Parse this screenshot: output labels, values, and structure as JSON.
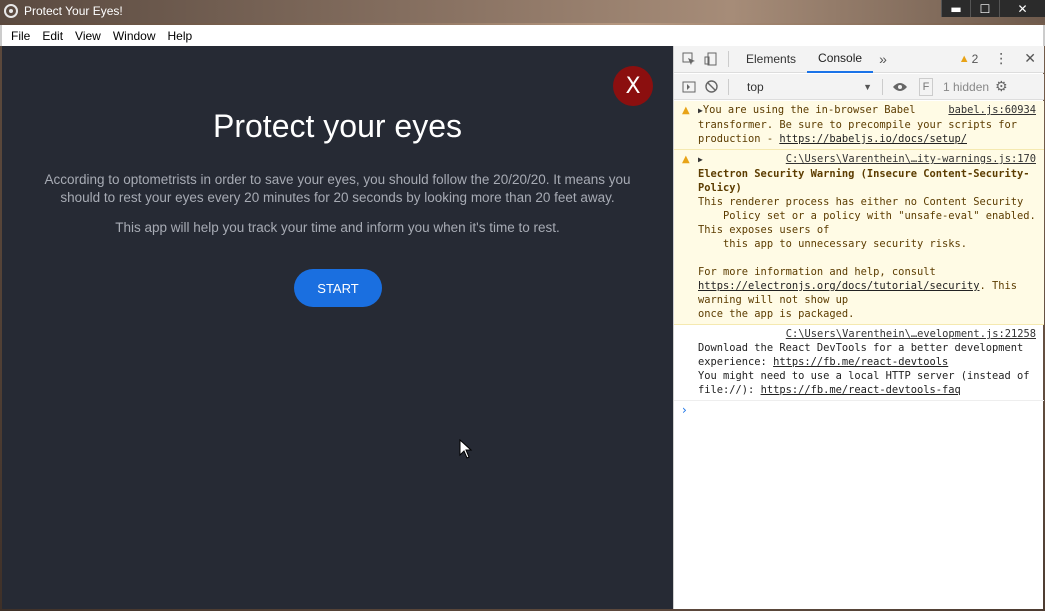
{
  "window": {
    "title": "Protect Your Eyes!",
    "controls": {
      "minimize": "▬",
      "maximize": "☐",
      "close": "✕"
    }
  },
  "menu": [
    "File",
    "Edit",
    "View",
    "Window",
    "Help"
  ],
  "app": {
    "close_label": "X",
    "title": "Protect your eyes",
    "desc_line1": "According to optometrists in order to save your eyes, you should follow the 20/20/20. It means you",
    "desc_line2": "should to rest your eyes every 20 minutes for 20 seconds by looking more than 20 feet away.",
    "desc2": "This app will help you track your time and inform you when it's time to rest.",
    "start_label": "START"
  },
  "devtools": {
    "tabs": [
      "Elements",
      "Console"
    ],
    "active_tab": "Console",
    "more": "»",
    "warning_count": "2",
    "context": "top",
    "filter_placeholder": "F",
    "hidden_count": "1 hidden",
    "messages": [
      {
        "level": "warn",
        "source": "babel.js:60934",
        "line1": "You are using the in-browser",
        "rest": "Babel transformer. Be sure to precompile your scripts for production - ",
        "link": "https://babeljs.io/docs/setup/"
      },
      {
        "level": "warn",
        "source": "C:\\Users\\Varenthein\\…ity-warnings.js:170",
        "heading": "Electron Security Warning (Insecure Content-Security-Policy)",
        "body": "This renderer process has either no Content Security\n    Policy set or a policy with \"unsafe-eval\" enabled. This exposes users of\n    this app to unnecessary security risks.",
        "help_prefix": "For more information and help, consult",
        "help_link": "https://electronjs.org/docs/tutorial/security",
        "help_suffix": ". This warning will not show up\nonce the app is packaged."
      },
      {
        "level": "log",
        "source": "C:\\Users\\Varenthein\\…evelopment.js:21258",
        "line1": "Download the React DevTools for a better development experience: ",
        "link1": "https://fb.me/react-devtools",
        "line2": "You might need to use a local HTTP server (instead of file://): ",
        "link2": "https://fb.me/react-devtools-faq"
      }
    ],
    "prompt": "›"
  }
}
